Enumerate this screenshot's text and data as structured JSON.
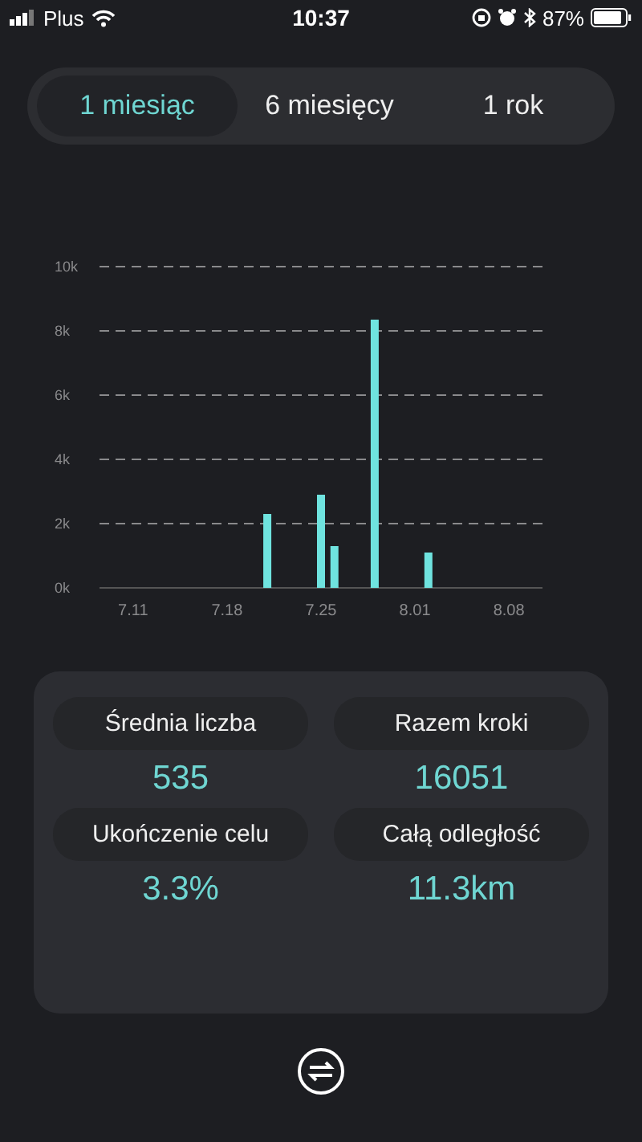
{
  "status_bar": {
    "carrier": "Plus",
    "time": "10:37",
    "battery": "87%"
  },
  "tabs": [
    {
      "label": "1 miesiąc",
      "selected": true
    },
    {
      "label": "6 miesięcy",
      "selected": false
    },
    {
      "label": "1 rok",
      "selected": false
    }
  ],
  "chart": {
    "chart_data": {
      "type": "bar",
      "categories": [
        null,
        null,
        "7.11",
        null,
        null,
        null,
        null,
        null,
        null,
        "7.18",
        null,
        null,
        null,
        null,
        null,
        null,
        "7.25",
        null,
        null,
        null,
        null,
        null,
        null,
        "8.01",
        null,
        null,
        null,
        null,
        null,
        null,
        "8.08",
        null,
        null
      ],
      "values": [
        0,
        0,
        0,
        0,
        0,
        0,
        0,
        0,
        0,
        0,
        0,
        0,
        2300,
        0,
        0,
        0,
        2900,
        1300,
        0,
        0,
        8350,
        0,
        0,
        0,
        1100,
        0,
        0,
        0,
        0,
        0,
        0,
        0,
        0
      ],
      "ylim": [
        0,
        10000
      ],
      "grid": true,
      "yticks": [
        {
          "value": 0,
          "label": "0k"
        },
        {
          "value": 2000,
          "label": "2k"
        },
        {
          "value": 4000,
          "label": "4k"
        },
        {
          "value": 6000,
          "label": "6k"
        },
        {
          "value": 8000,
          "label": "8k"
        },
        {
          "value": 10000,
          "label": "10k"
        }
      ]
    }
  },
  "stats": [
    {
      "label": "Średnia liczba",
      "value": "535"
    },
    {
      "label": "Razem kroki",
      "value": "16051"
    },
    {
      "label": "Ukończenie celu",
      "value": "3.3%"
    },
    {
      "label": "Całą odległość",
      "value": "11.3km"
    }
  ]
}
